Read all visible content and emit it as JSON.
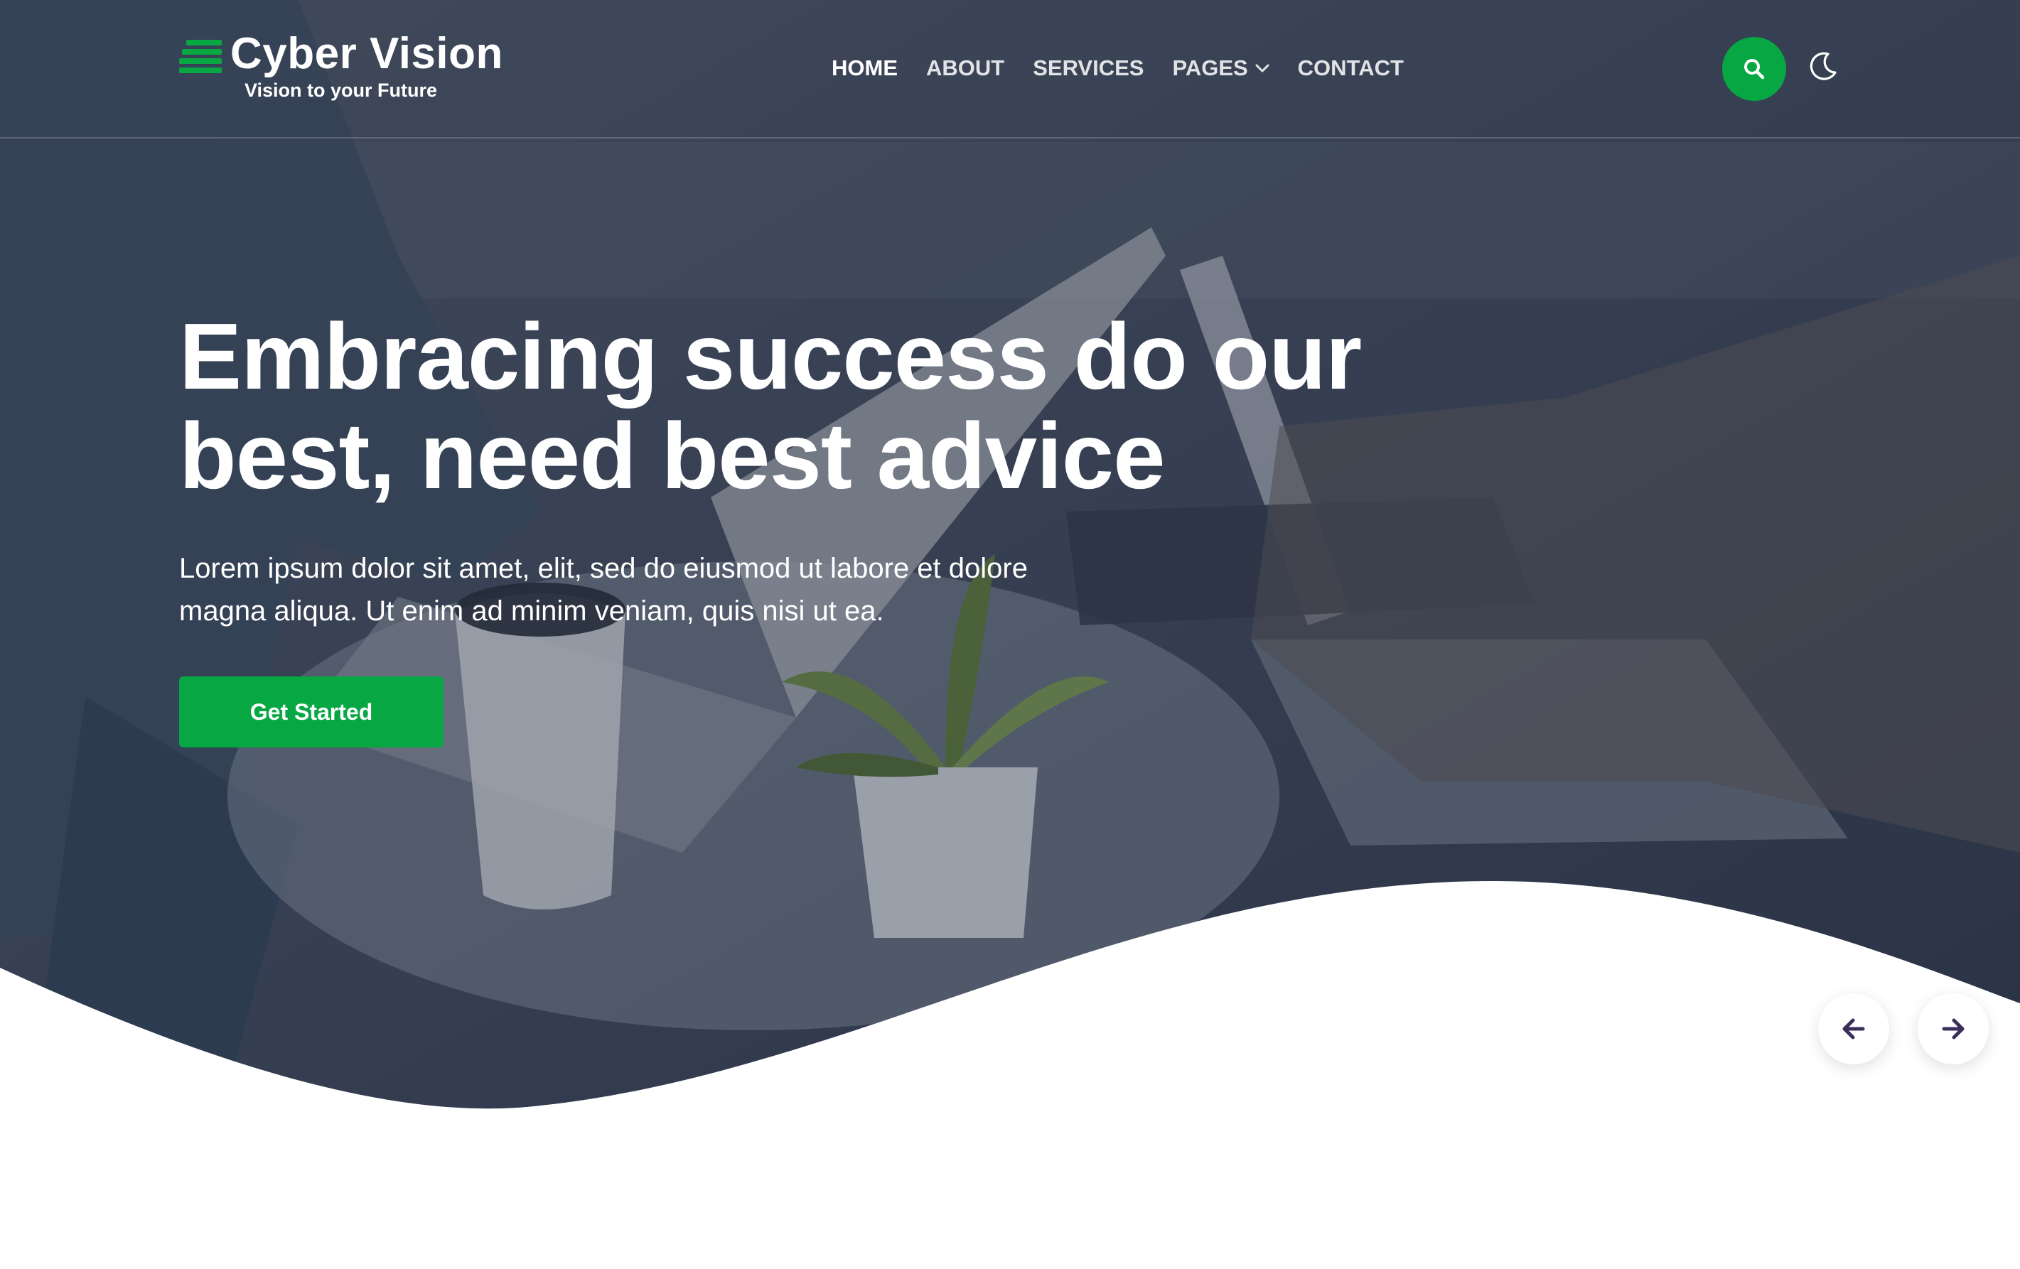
{
  "brand": {
    "name": "Cyber Vision",
    "tagline": "Vision to your Future",
    "logo_icon": "stacked-lines-icon"
  },
  "nav": {
    "items": [
      {
        "label": "HOME",
        "active": true
      },
      {
        "label": "ABOUT",
        "active": false
      },
      {
        "label": "SERVICES",
        "active": false
      },
      {
        "label": "PAGES",
        "active": false,
        "has_dropdown": true
      },
      {
        "label": "CONTACT",
        "active": false
      }
    ]
  },
  "header_actions": {
    "search_icon": "search-icon",
    "theme_icon": "moon-icon"
  },
  "hero": {
    "headline_line1": "Embracing success do our",
    "headline_line2": "best, need best advice",
    "description_line1": "Lorem ipsum dolor sit amet, elit, sed do eiusmod ut labore et dolore",
    "description_line2": "magna aliqua. Ut enim ad minim veniam, quis nisi ut ea.",
    "cta_label": "Get Started",
    "prev_icon": "arrow-left-icon",
    "next_icon": "arrow-right-icon"
  },
  "colors": {
    "accent": "#07a844",
    "overlay": "#3b4556",
    "arrow_icon": "#3a2f5b"
  }
}
